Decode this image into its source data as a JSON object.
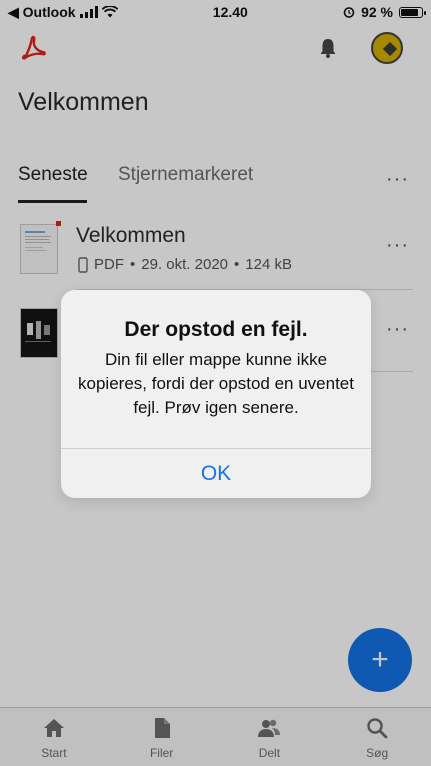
{
  "statusbar": {
    "back_app": "◀ Outlook",
    "time": "12.40",
    "battery": "92 %",
    "battery_fraction": 0.92
  },
  "header": {
    "title": "Velkommen"
  },
  "tabs": [
    {
      "label": "Seneste",
      "active": true
    },
    {
      "label": "Stjernemarkeret",
      "active": false
    }
  ],
  "files": [
    {
      "name": "Velkommen",
      "type": "PDF",
      "date": "29. okt. 2020",
      "size": "124 kB",
      "separator": "•"
    },
    {
      "name": "",
      "type": "",
      "date": "",
      "size": ""
    }
  ],
  "more_label": "···",
  "fab_label": "+",
  "bottom_nav": [
    {
      "label": "Start",
      "icon": "home-icon"
    },
    {
      "label": "Filer",
      "icon": "file-icon"
    },
    {
      "label": "Delt",
      "icon": "people-icon"
    },
    {
      "label": "Søg",
      "icon": "search-icon"
    }
  ],
  "alert": {
    "title": "Der opstod en fejl.",
    "message": "Din fil eller mappe kunne ikke kopieres, fordi der opstod en uventet fejl. Prøv igen senere.",
    "ok_label": "OK"
  },
  "colors": {
    "accent": "#1473e6",
    "alert_button": "#1a73e8",
    "acrobat_red": "#e1251b"
  }
}
